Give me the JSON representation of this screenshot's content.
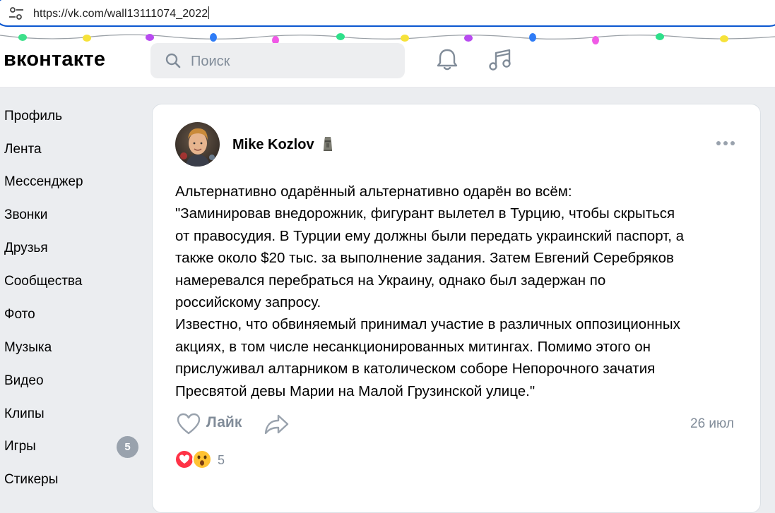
{
  "browser": {
    "url": "https://vk.com/wall13111074_2022"
  },
  "header": {
    "logo": "вконтакте",
    "search_placeholder": "Поиск",
    "icons": [
      "notifications-bell-icon",
      "music-note-icon"
    ]
  },
  "sidebar": {
    "items": [
      {
        "label": "Профиль"
      },
      {
        "label": "Лента"
      },
      {
        "label": "Мессенджер"
      },
      {
        "label": "Звонки"
      },
      {
        "label": "Друзья"
      },
      {
        "label": "Сообщества"
      },
      {
        "label": "Фото"
      },
      {
        "label": "Музыка"
      },
      {
        "label": "Видео"
      },
      {
        "label": "Клипы"
      },
      {
        "label": "Игры",
        "badge": "5"
      },
      {
        "label": "Стикеры"
      }
    ]
  },
  "post": {
    "author": "Mike Kozlov",
    "author_emoji": "moai-icon",
    "text_lines": [
      "Альтернативно одарённый альтернативно одарён во всём:",
      "\"Заминировав внедорожник, фигурант вылетел в Турцию, чтобы скрыться",
      "от правосудия. В Турции ему должны были передать украинский паспорт, а",
      "также около $20 тыс. за выполнение задания. Затем Евгений Серебряков",
      "намеревался перебраться на Украину, однако был задержан по",
      "российскому запросу.",
      "Известно, что обвиняемый принимал участие в различных оппозиционных",
      "акциях, в том числе несанкционированных митингах. Помимо этого он",
      "прислуживал алтарником в католическом соборе Непорочного зачатия",
      "Пресвятой девы Марии на Малой Грузинской улице.\""
    ],
    "like_label": "Лайк",
    "date": "26 июл",
    "reactions_count": "5",
    "reaction_icons": [
      "heart-reaction-icon",
      "surprised-reaction-icon"
    ]
  },
  "colors": {
    "accent_blue": "#0b57d0",
    "muted_text": "#818c99",
    "background": "#ebedf0",
    "badge": "#99a2ad"
  }
}
